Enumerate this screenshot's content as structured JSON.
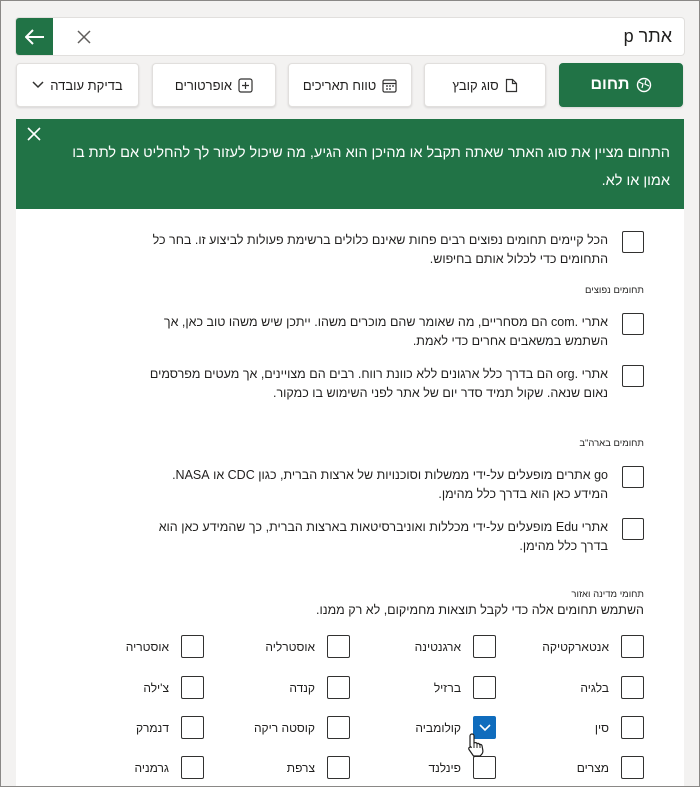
{
  "search": {
    "value": "אתר p"
  },
  "toolbar": {
    "domain_label": "תחום",
    "filetype_label": "סוג קובץ",
    "daterange_label": "טווח תאריכים",
    "operators_label": "אופרטורים",
    "worktest_label": "בדיקת עובדה"
  },
  "banner": {
    "text": "התחום מציין את סוג האתר שאתה תקבל או מהיכן הוא הגיע, מה שיכול לעזור לך להחליט אם לתת בו אמון או לא."
  },
  "all_domains": {
    "text": "הכל קיימים תחומים נפוצים רבים פחות שאינם כלולים ברשימת פעולות לביצוע זו. בחר כל התחומים כדי לכלול אותם בחיפוש."
  },
  "common": {
    "title": "תחומים נפוצים",
    "com": "אתרי .com הם מסחריים, מה שאומר שהם מוכרים משהו. ייתכן שיש משהו טוב כאן, אך השתמש במשאבים אחרים כדי לאמת.",
    "org": "אתרי .org הם בדרך כלל ארגונים ללא כוונת רווח. רבים הם מצויינים, אך מעטים מפרסמים נאום שנאה. שקול תמיד סדר יום של אתר לפני השימוש בו כמקור."
  },
  "usa": {
    "title": "תחומים בארה\"ב",
    "gov": "go אתרים מופעלים על-ידי ממשלות וסוכנויות של ארצות הברית, כגון CDC או NASA. המידע כאן הוא בדרך כלל מהימן.",
    "edu": "אתרי Edu מופעלים על-ידי מכללות ואוניברסיטאות בארצות הברית, כך שהמידע כאן הוא בדרך כלל מהימן."
  },
  "country": {
    "title": "תחומי מדינה ואזור",
    "desc": "השתמש תחומים אלה כדי לקבל תוצאות מחמיקום, לא רק ממנו.",
    "items": [
      {
        "label": "אנטארקטיקה",
        "checked": false
      },
      {
        "label": "ארגנטינה",
        "checked": false
      },
      {
        "label": "אוסטרליה",
        "checked": false
      },
      {
        "label": "אוסטריה",
        "checked": false
      },
      {
        "label": "בלגיה",
        "checked": false
      },
      {
        "label": "ברזיל",
        "checked": false
      },
      {
        "label": "קנדה",
        "checked": false
      },
      {
        "label": "צ'ילה",
        "checked": false
      },
      {
        "label": "סין",
        "checked": false
      },
      {
        "label": "קולומביה",
        "checked": true
      },
      {
        "label": "קוסטה ריקה",
        "checked": false
      },
      {
        "label": "דנמרק",
        "checked": false
      },
      {
        "label": "מצרים",
        "checked": false
      },
      {
        "label": "פינלנד",
        "checked": false
      },
      {
        "label": "צרפת",
        "checked": false
      },
      {
        "label": "גרמניה",
        "checked": false
      }
    ]
  },
  "colors": {
    "accent": "#217346",
    "checked": "#0f6cbd"
  }
}
